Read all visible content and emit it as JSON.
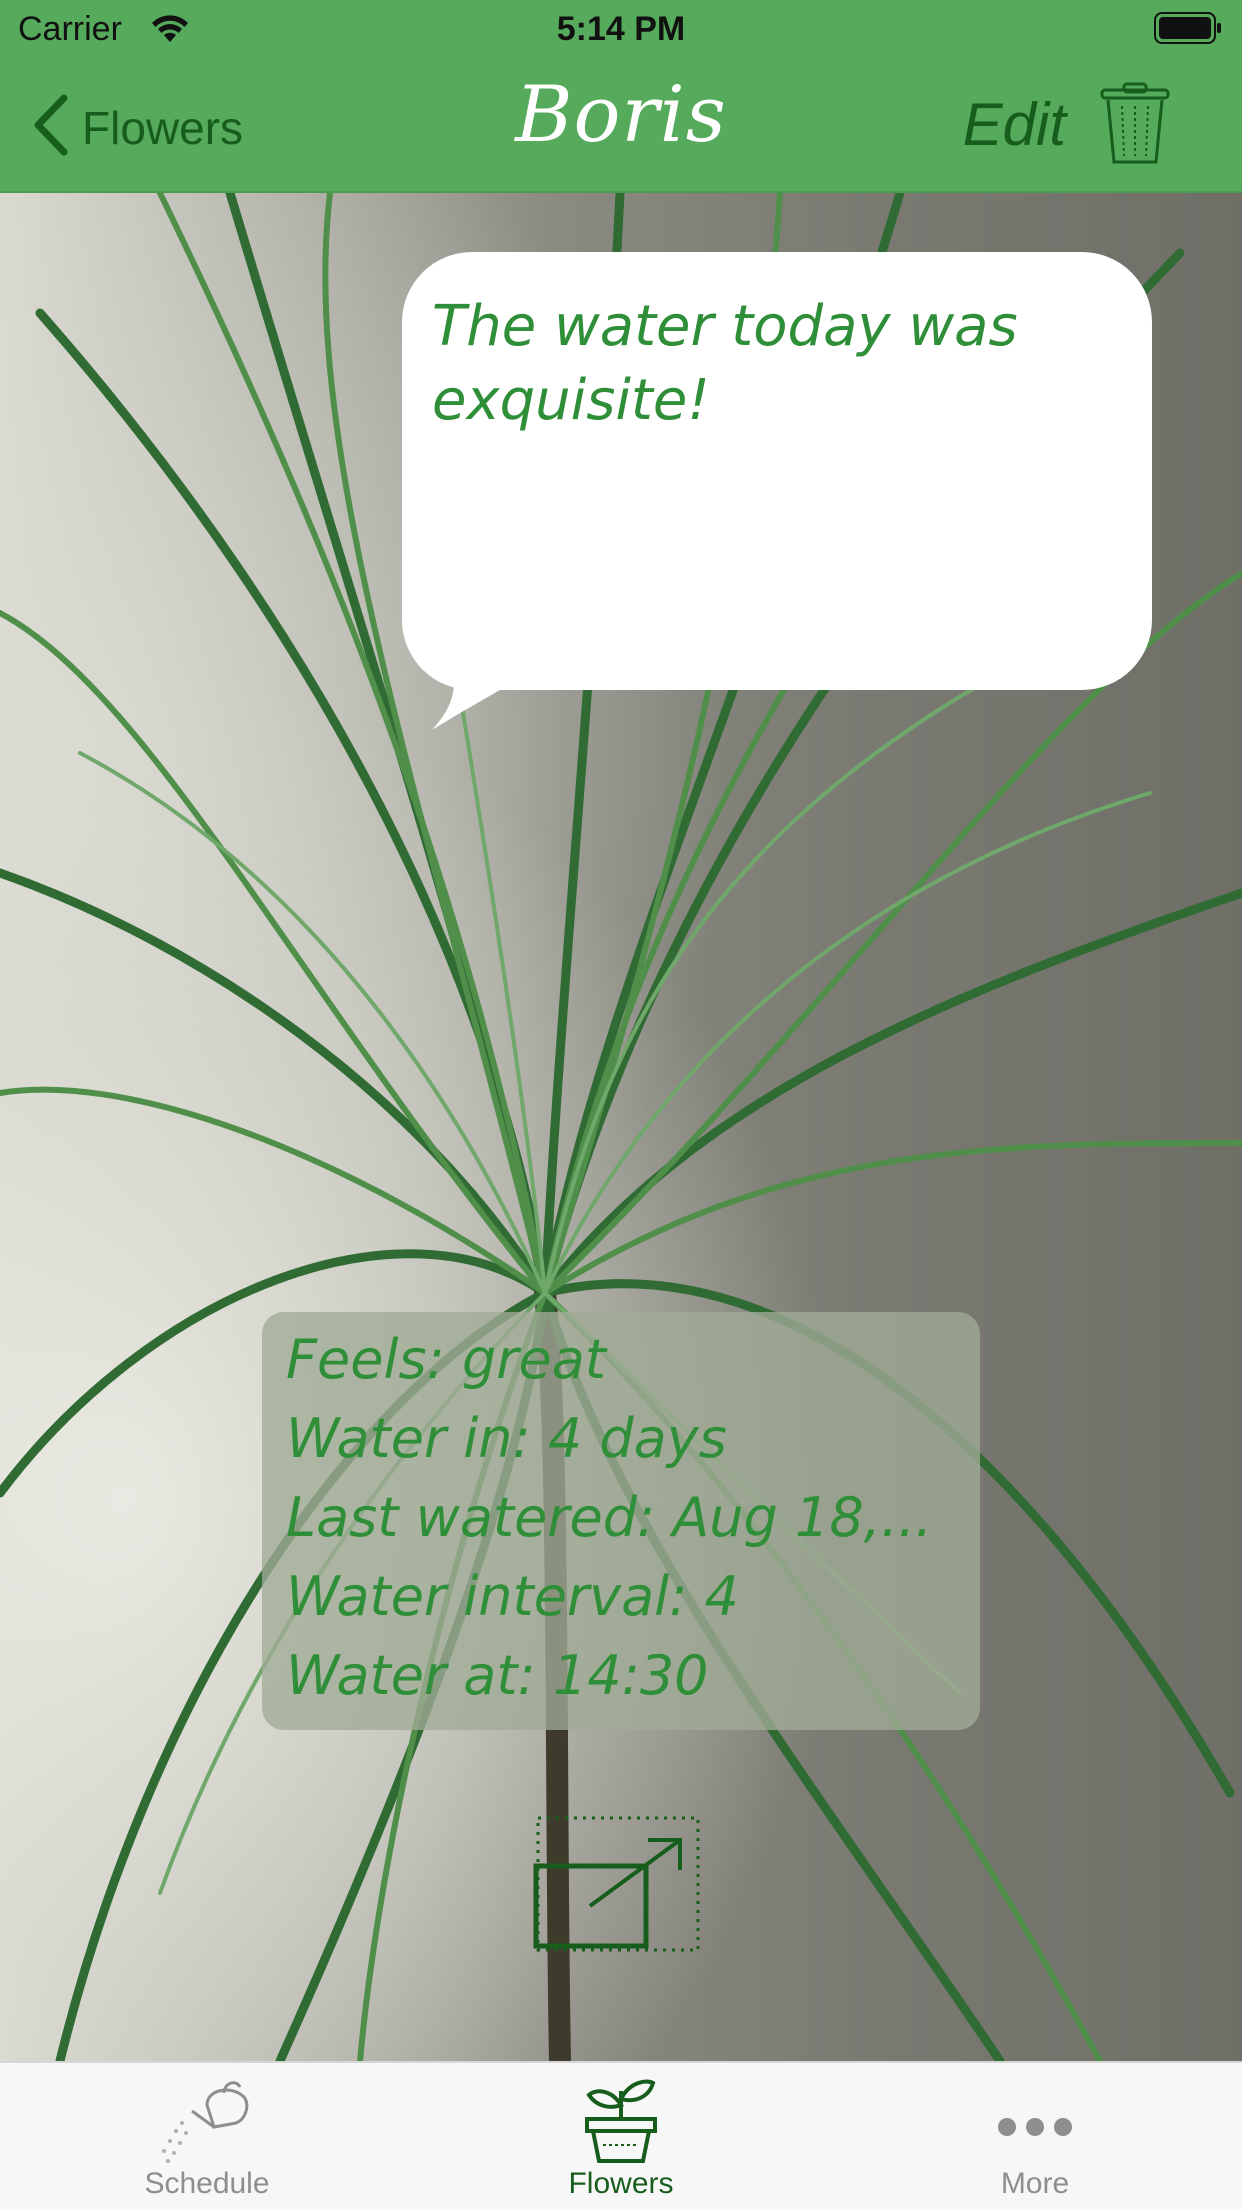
{
  "status": {
    "carrier": "Carrier",
    "time": "5:14 PM"
  },
  "nav": {
    "back_label": "Flowers",
    "title": "Boris",
    "edit_label": "Edit"
  },
  "bubble": {
    "text": "The water today was exquisite!"
  },
  "info": {
    "lines": [
      "Feels: great",
      "Water in: 4 days",
      "Last watered: Aug 18,...",
      "Water interval: 4",
      "Water at: 14:30"
    ]
  },
  "tabs": [
    {
      "label": "Schedule",
      "icon": "watering-can-icon",
      "selected": false
    },
    {
      "label": "Flowers",
      "icon": "plant-pot-icon",
      "selected": true
    },
    {
      "label": "More",
      "icon": "more-dots-icon",
      "selected": false
    }
  ],
  "colors": {
    "nav_bg": "#55aa5b",
    "nav_accent": "#175d1c",
    "text_green": "#2f8f38",
    "tab_selected": "#175d1c",
    "tab_unselected": "#8e8e8e"
  }
}
